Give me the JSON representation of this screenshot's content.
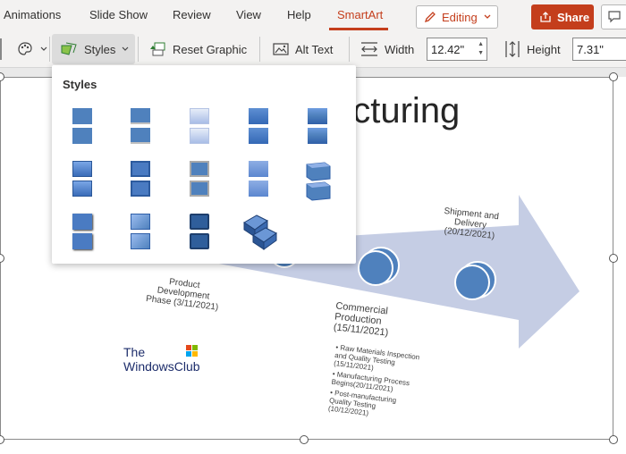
{
  "tabs": [
    {
      "label": "Animations",
      "active": false
    },
    {
      "label": "Slide Show",
      "active": false
    },
    {
      "label": "Review",
      "active": false
    },
    {
      "label": "View",
      "active": false
    },
    {
      "label": "Help",
      "active": false
    },
    {
      "label": "SmartArt",
      "active": true
    }
  ],
  "header": {
    "editing_label": "Editing",
    "share_label": "Share"
  },
  "toolbar": {
    "styles_label": "Styles",
    "reset_label": "Reset Graphic",
    "alt_text_label": "Alt Text",
    "width_label": "Width",
    "width_value": "12.42\"",
    "height_label": "Height",
    "height_value": "7.31\""
  },
  "dropdown": {
    "title": "Styles",
    "option_count": 14
  },
  "slide": {
    "title_fragment": "acturing",
    "labels": {
      "shipment": "Shipment and Delivery (20/12/2021)",
      "product": "Product Development Phase (3/11/2021)",
      "commercial": "Commercial Production (15/11/2021)"
    },
    "bullets": [
      "Raw Materials Inspection and Quality Testing (15/11/2021)",
      "Manufacturing Process Begins(20/11/2021)",
      "Post-manufacturing Quality Testing (10/12/2021)"
    ]
  },
  "watermark": {
    "line1": "The",
    "line2": "WindowsClub"
  },
  "colors": {
    "accent": "#c43e1c",
    "smartart_blue": "#4f81bd",
    "arrow": "#c5cde4"
  }
}
